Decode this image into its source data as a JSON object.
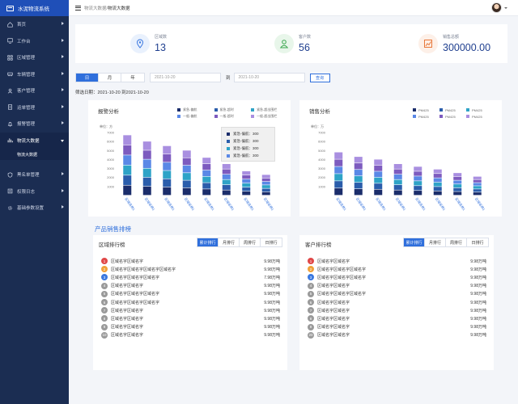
{
  "app": {
    "title": "水泥物流系统"
  },
  "sidebar": {
    "items": [
      {
        "label": "首页",
        "icon": "home-icon"
      },
      {
        "label": "工作台",
        "icon": "desktop-icon"
      },
      {
        "label": "区域管理",
        "icon": "grid-icon"
      },
      {
        "label": "车辆管理",
        "icon": "car-icon"
      },
      {
        "label": "客户管理",
        "icon": "user-icon"
      },
      {
        "label": "运单管理",
        "icon": "document-icon"
      },
      {
        "label": "报警管理",
        "icon": "bell-icon"
      },
      {
        "label": "物流大数据",
        "icon": "chart-icon",
        "active": true
      },
      {
        "label": "黑名单管理",
        "icon": "shield-icon"
      },
      {
        "label": "权限日志",
        "icon": "log-icon"
      },
      {
        "label": "基础参数设置",
        "icon": "gear-icon"
      }
    ],
    "submenu": {
      "label": "物流大数据"
    }
  },
  "header": {
    "breadcrumb_parent": "物流大数据",
    "breadcrumb_sep": "/",
    "breadcrumb_current": "物流大数据"
  },
  "stats": [
    {
      "label": "区域数",
      "value": "13",
      "icon": "location-icon",
      "color": "#3a78e0",
      "bg": "#e9f1fd"
    },
    {
      "label": "客户数",
      "value": "56",
      "icon": "person-icon",
      "color": "#3aa64e",
      "bg": "#e8f6ea"
    },
    {
      "label": "销售总额",
      "value": "300000.00",
      "icon": "sales-chart-icon",
      "color": "#e8783a",
      "bg": "#fdf0e8"
    }
  ],
  "filter": {
    "periods": [
      "日",
      "月",
      "年"
    ],
    "start_date": "2021-10-20",
    "to_label": "到",
    "end_date": "2021-10-20",
    "search_label": "查询",
    "note": "筛选日期：2021-10-20 到2021-10-20"
  },
  "alarm_chart": {
    "title": "报警分析",
    "legend": [
      {
        "name": "紧急-偏航",
        "color": "#1b2d6b"
      },
      {
        "name": "紧急-超时",
        "color": "#2a5dab"
      },
      {
        "name": "紧急-超出围栏",
        "color": "#2ea3c7"
      },
      {
        "name": "一般-偏航",
        "color": "#5a88e6"
      },
      {
        "name": "一般-超时",
        "color": "#7d5bbf"
      },
      {
        "name": "一般-超出围栏",
        "color": "#a98fe0"
      }
    ]
  },
  "sales_chart": {
    "title": "销售分析",
    "legend": [
      {
        "name": "PM425",
        "color": "#1b2d6b"
      },
      {
        "name": "PM425",
        "color": "#2a5dab"
      },
      {
        "name": "PM425",
        "color": "#2ea3c7"
      },
      {
        "name": "PM425",
        "color": "#5a88e6"
      },
      {
        "name": "PM425",
        "color": "#7d5bbf"
      },
      {
        "name": "PM425",
        "color": "#a98fe0"
      }
    ]
  },
  "chart_data": [
    {
      "type": "bar",
      "title": "报警分析",
      "ylabel": "单位：方",
      "categories": [
        "区域名称1",
        "区域名称1",
        "区域名称1",
        "区域名称1",
        "区域名称1",
        "区域名称1",
        "区域名称1",
        "区域名称1"
      ],
      "yticks": [
        "1000",
        "2000",
        "3000",
        "4000",
        "5000",
        "6000",
        "7000"
      ],
      "series": [
        {
          "name": "紧急-偏航",
          "values": [
            300,
            300,
            300,
            300,
            300,
            300,
            300,
            300
          ]
        },
        {
          "name": "紧急-超时",
          "values": [
            300,
            300,
            300,
            300,
            300,
            300,
            300,
            300
          ]
        },
        {
          "name": "紧急-超出围栏",
          "values": [
            300,
            300,
            300,
            300,
            300,
            300,
            300,
            300
          ]
        },
        {
          "name": "一般-偏航",
          "values": [
            300,
            300,
            300,
            300,
            300,
            300,
            300,
            300
          ]
        },
        {
          "name": "一般-超时",
          "values": [
            300,
            300,
            300,
            300,
            300,
            300,
            300,
            300
          ]
        },
        {
          "name": "一般-超出围栏",
          "values": [
            300,
            300,
            300,
            300,
            300,
            300,
            300,
            300
          ]
        }
      ],
      "totals": [
        6700,
        6000,
        5500,
        5000,
        4200,
        3500,
        2700,
        2300
      ],
      "ylim": [
        0,
        7000
      ],
      "tooltip": {
        "rows": [
          {
            "name": "紧急-偏航",
            "value": "300",
            "color": "#1b2d6b"
          },
          {
            "name": "紧急-偏航",
            "value": "300",
            "color": "#2a5dab"
          },
          {
            "name": "紧急-偏航",
            "value": "300",
            "color": "#2ea3c7"
          },
          {
            "name": "紧急-偏航",
            "value": "300",
            "color": "#5a88e6"
          }
        ]
      }
    },
    {
      "type": "bar",
      "title": "销售分析",
      "ylabel": "单位：万",
      "categories": [
        "区域名称1",
        "区域名称1",
        "区域名称1",
        "区域名称1",
        "区域名称1",
        "区域名称1",
        "区域名称1",
        "区域名称1"
      ],
      "yticks": [
        "1000",
        "2000",
        "3000",
        "4000",
        "5000",
        "6000",
        "7000"
      ],
      "totals": [
        4800,
        4300,
        4000,
        3500,
        3200,
        2900,
        2500,
        2100
      ],
      "ylim": [
        0,
        7000
      ]
    }
  ],
  "section": {
    "title": "产品销售排榜"
  },
  "region_rank": {
    "title": "区域排行榜",
    "tabs": [
      "累计排行",
      "月排行",
      "周排行",
      "日排行"
    ],
    "rows": [
      {
        "n": "1",
        "name": "区域名字区域名字",
        "value": "9.98万吨",
        "color": "#e04848"
      },
      {
        "n": "2",
        "name": "区域名字区域名字区域名字区域名字",
        "value": "9.98万吨",
        "color": "#f0a23a"
      },
      {
        "n": "3",
        "name": "区域名字区域名字区域名字",
        "value": "7.98万吨",
        "color": "#3a78e0"
      },
      {
        "n": "4",
        "name": "区域名字区域名字",
        "value": "9.98万吨",
        "color": "#9a9a9a"
      },
      {
        "n": "5",
        "name": "区域名字区域名字区域名字",
        "value": "9.98万吨",
        "color": "#9a9a9a"
      },
      {
        "n": "6",
        "name": "区域名字区域名字区域名字",
        "value": "9.98万吨",
        "color": "#9a9a9a"
      },
      {
        "n": "7",
        "name": "区域名字区域名字",
        "value": "9.98万吨",
        "color": "#9a9a9a"
      },
      {
        "n": "8",
        "name": "区域名字区域名字",
        "value": "9.98万吨",
        "color": "#9a9a9a"
      },
      {
        "n": "9",
        "name": "区域名字区域名字",
        "value": "9.98万吨",
        "color": "#9a9a9a"
      },
      {
        "n": "10",
        "name": "区域名字区域名字",
        "value": "9.98万吨",
        "color": "#9a9a9a"
      }
    ]
  },
  "customer_rank": {
    "title": "客户排行榜",
    "tabs": [
      "累计排行",
      "月排行",
      "周排行",
      "日排行"
    ],
    "rows": [
      {
        "n": "1",
        "name": "区域名字区域名字",
        "value": "9.98万吨",
        "color": "#e04848"
      },
      {
        "n": "2",
        "name": "区域名字区域名字区域名字",
        "value": "9.98万吨",
        "color": "#f0a23a"
      },
      {
        "n": "3",
        "name": "区域名字区域名字区域名字",
        "value": "9.98万吨",
        "color": "#3a78e0"
      },
      {
        "n": "4",
        "name": "区域名字区域名字",
        "value": "9.98万吨",
        "color": "#9a9a9a"
      },
      {
        "n": "5",
        "name": "区域名字区域名字区域名字",
        "value": "9.98万吨",
        "color": "#9a9a9a"
      },
      {
        "n": "6",
        "name": "区域名字区域名字",
        "value": "9.98万吨",
        "color": "#9a9a9a"
      },
      {
        "n": "7",
        "name": "区域名字区域名字",
        "value": "9.98万吨",
        "color": "#9a9a9a"
      },
      {
        "n": "8",
        "name": "区域名字区域名字",
        "value": "9.98万吨",
        "color": "#9a9a9a"
      },
      {
        "n": "9",
        "name": "区域名字区域名字",
        "value": "9.98万吨",
        "color": "#9a9a9a"
      },
      {
        "n": "20",
        "name": "区域名字区域名字",
        "value": "9.98万吨",
        "color": "#9a9a9a"
      }
    ]
  }
}
